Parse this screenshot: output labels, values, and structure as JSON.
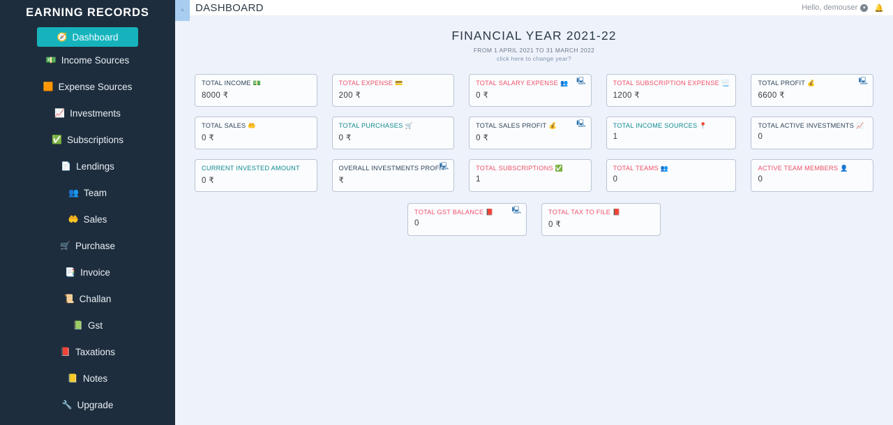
{
  "sidebar": {
    "brand": "EARNING RECORDS",
    "items": [
      {
        "label": "Dashboard",
        "icon": "compass-icon",
        "glyph": "🧭",
        "active": true
      },
      {
        "label": "Income Sources",
        "icon": "money-bill-icon",
        "glyph": "💵",
        "active": false
      },
      {
        "label": "Expense Sources",
        "icon": "wallet-icon",
        "glyph": "🟧",
        "active": false
      },
      {
        "label": "Investments",
        "icon": "chart-line-icon",
        "glyph": "📈",
        "active": false
      },
      {
        "label": "Subscriptions",
        "icon": "check-circle-icon",
        "glyph": "✅",
        "active": false
      },
      {
        "label": "Lendings",
        "icon": "document-icon",
        "glyph": "📄",
        "active": false
      },
      {
        "label": "Team",
        "icon": "users-icon",
        "glyph": "👥",
        "active": false
      },
      {
        "label": "Sales",
        "icon": "handshake-icon",
        "glyph": "🤲",
        "active": false
      },
      {
        "label": "Purchase",
        "icon": "cart-icon",
        "glyph": "🛒",
        "active": false
      },
      {
        "label": "Invoice",
        "icon": "invoice-icon",
        "glyph": "📑",
        "active": false
      },
      {
        "label": "Challan",
        "icon": "scroll-icon",
        "glyph": "📜",
        "active": false
      },
      {
        "label": "Gst",
        "icon": "file-teal-icon",
        "glyph": "📗",
        "active": false
      },
      {
        "label": "Taxations",
        "icon": "file-red-icon",
        "glyph": "📕",
        "active": false
      },
      {
        "label": "Notes",
        "icon": "notes-icon",
        "glyph": "📒",
        "active": false
      },
      {
        "label": "Upgrade",
        "icon": "wrench-icon",
        "glyph": "🔧",
        "active": false
      }
    ]
  },
  "topbar": {
    "collapse_label": "×",
    "page_title": "DASHBOARD",
    "greeting": "Hello, demouser",
    "chevron": "▾",
    "bell": "🔔"
  },
  "financial_year": {
    "title": "FINANCIAL YEAR 2021-22",
    "range": "FROM 1 APRIL 2021 TO 31 MARCH 2022",
    "change_link": "click here to change year?"
  },
  "colors": {
    "sidebar_bg": "#1e2d3d",
    "active_nav": "#17b3bd",
    "content_bg": "#eef2fa",
    "label_dark": "#2c4257",
    "label_teal": "#0f8a8f",
    "label_red": "#ef5068",
    "card_border": "#b9c5d4"
  },
  "cards": [
    {
      "label": "TOTAL INCOME",
      "value": "8000 ₹",
      "tone": "dark",
      "icon": "money-bill-icon",
      "glyph": "💵",
      "calc": false
    },
    {
      "label": "TOTAL EXPENSE",
      "value": "200 ₹",
      "tone": "red",
      "icon": "credit-card-icon",
      "glyph": "💳",
      "calc": false
    },
    {
      "label": "TOTAL SALARY EXPENSE",
      "value": "0 ₹",
      "tone": "red",
      "icon": "users-icon",
      "glyph": "👥",
      "calc": true
    },
    {
      "label": "TOTAL SUBSCRIPTION EXPENSE",
      "value": "1200 ₹",
      "tone": "red",
      "icon": "list-icon",
      "glyph": "📃",
      "calc": false
    },
    {
      "label": "TOTAL PROFIT",
      "value": "6600 ₹",
      "tone": "dark",
      "icon": "coins-icon",
      "glyph": "💰",
      "calc": true
    },
    {
      "label": "TOTAL SALES",
      "value": "0 ₹",
      "tone": "dark",
      "icon": "handshake-icon",
      "glyph": "🤲",
      "calc": false
    },
    {
      "label": "TOTAL PURCHASES",
      "value": "0 ₹",
      "tone": "teal",
      "icon": "cart-icon",
      "glyph": "🛒",
      "calc": false
    },
    {
      "label": "TOTAL SALES PROFIT",
      "value": "0 ₹",
      "tone": "dark",
      "icon": "coins-icon",
      "glyph": "💰",
      "calc": true
    },
    {
      "label": "TOTAL INCOME SOURCES",
      "value": "1",
      "tone": "teal",
      "icon": "location-pin-icon",
      "glyph": "📍",
      "calc": false
    },
    {
      "label": "TOTAL ACTIVE INVESTMENTS",
      "value": "0",
      "tone": "dark",
      "icon": "chart-line-icon",
      "glyph": "📈",
      "calc": false
    },
    {
      "label": "CURRENT INVESTED AMOUNT",
      "value": "0 ₹",
      "tone": "teal",
      "icon": "none",
      "glyph": "",
      "calc": false
    },
    {
      "label": "OVERALL INVESTMENTS PROFIT",
      "value": "₹",
      "tone": "dark",
      "icon": "none",
      "glyph": "",
      "calc": true
    },
    {
      "label": "TOTAL SUBSCRIPTIONS",
      "value": "1",
      "tone": "red",
      "icon": "check-circle-icon",
      "glyph": "✅",
      "calc": false
    },
    {
      "label": "TOTAL TEAMS",
      "value": "0",
      "tone": "red",
      "icon": "users-icon",
      "glyph": "👥",
      "calc": false
    },
    {
      "label": "ACTIVE TEAM MEMBERS",
      "value": "0",
      "tone": "red",
      "icon": "user-icon",
      "glyph": "👤",
      "calc": false
    }
  ],
  "cards_bottom": [
    {
      "label": "TOTAL GST BALANCE",
      "value": "0",
      "tone": "red",
      "icon": "file-red-icon",
      "glyph": "📕",
      "calc": true
    },
    {
      "label": "TOTAL TAX TO FILE",
      "value": "0 ₹",
      "tone": "red",
      "icon": "file-red-icon",
      "glyph": "📕",
      "calc": false
    }
  ],
  "calc_icon_glyph": "🖳"
}
